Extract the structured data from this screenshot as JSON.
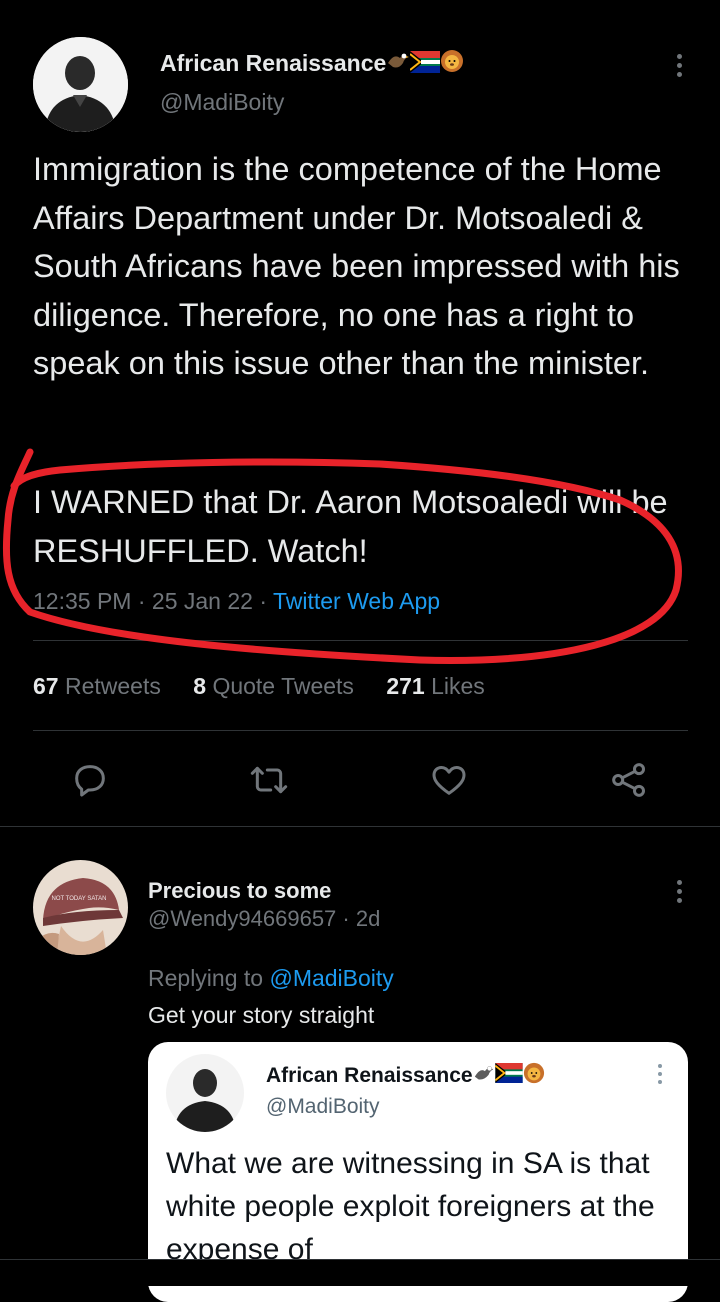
{
  "main_tweet": {
    "display_name": "African Renaissance",
    "handle": "@MadiBoity",
    "paragraph1": "Immigration is the competence of the Home Affairs Department under Dr. Motsoaledi & South Africans have been impressed with his diligence. Therefore, no one has a right to speak on this issue other than the minister.",
    "paragraph2": "I WARNED that Dr. Aaron Motsoaledi will be RESHUFFLED. Watch!",
    "time": "12:35 PM",
    "date": "25 Jan 22",
    "source": "Twitter Web App",
    "separator": "·"
  },
  "stats": {
    "retweets_count": "67",
    "retweets_label": "Retweets",
    "quotes_count": "8",
    "quotes_label": "Quote Tweets",
    "likes_count": "271",
    "likes_label": "Likes"
  },
  "actions": [
    "reply-icon",
    "retweet-icon",
    "like-icon",
    "share-icon"
  ],
  "reply": {
    "display_name": "Precious to some",
    "handle": "@Wendy94669657",
    "age": "2d",
    "separator": "·",
    "replying_to_label": "Replying to",
    "replying_to_handle": "@MadiBoity",
    "text": "Get your story straight",
    "cap_text": "NOT TODAY SATAN"
  },
  "quoted_tweet": {
    "display_name": "African Renaissance",
    "handle": "@MadiBoity",
    "text": "What we are witnessing in SA is that white people exploit foreigners at the expense of"
  },
  "colors": {
    "background": "#000000",
    "text": "#e7e9ea",
    "muted": "#71767b",
    "link": "#1d9bf0",
    "annotation": "#e8232a"
  }
}
